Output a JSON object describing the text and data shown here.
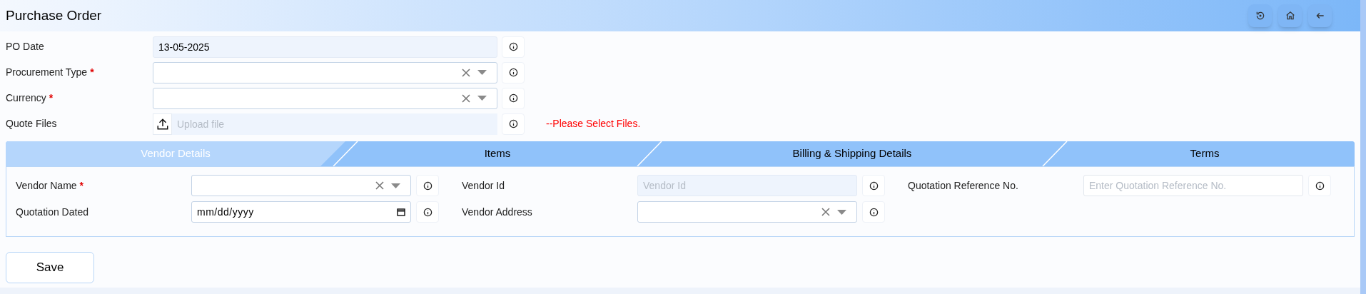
{
  "header": {
    "title": "Purchase Order",
    "buttons": [
      {
        "kind": "reset"
      },
      {
        "kind": "home"
      },
      {
        "kind": "back"
      }
    ]
  },
  "fields": [
    {
      "label": "PO Date",
      "kind": "text",
      "value": "13-05-2025",
      "disabled": true
    },
    {
      "label": "Procurement Type",
      "required_mark": "*",
      "kind": "select"
    },
    {
      "label": "Currency",
      "required_mark": "*",
      "kind": "select"
    },
    {
      "label": "Quote Files",
      "kind": "file",
      "placeholder": "Upload file",
      "error": "--Please Select Files."
    }
  ],
  "tabs": [
    {
      "label": "Vendor Details",
      "selected": true
    },
    {
      "label": "Items",
      "selected": false
    },
    {
      "label": "Billing & Shipping Details",
      "selected": false
    },
    {
      "label": "Terms",
      "selected": false
    }
  ],
  "vendor_fields": [
    {
      "label": "Vendor Name",
      "required_mark": "*",
      "kind": "select"
    },
    {
      "label": "Vendor Id",
      "kind": "text",
      "placeholder": "Vendor Id",
      "disabled": true
    },
    {
      "label": "Quotation Reference No.",
      "kind": "text",
      "placeholder": "Enter Quotation Reference No.",
      "disabled": false
    },
    {
      "label": "Quotation Dated",
      "kind": "date",
      "placeholder": "mm/dd/yyyy"
    },
    {
      "label": "Vendor Address",
      "kind": "select"
    }
  ],
  "save_button": "Save"
}
